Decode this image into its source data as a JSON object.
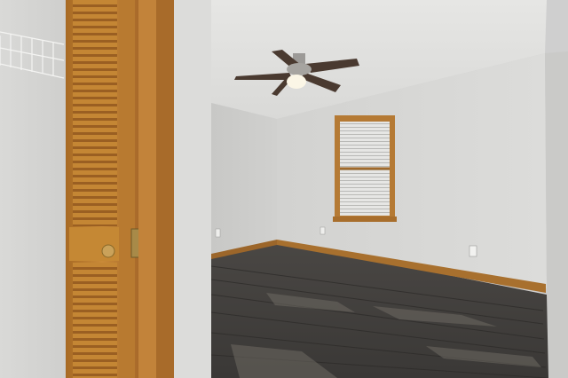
{
  "scene": {
    "kind": "photograph",
    "subject": "empty bedroom",
    "colors": {
      "wall": "#d6d6d4",
      "ceiling": "#e8e8e6",
      "wood_trim": "#b57a34",
      "door_wood": "#c0822f",
      "floor_dark": "#3f3d3b",
      "floor_light": "#6b6660",
      "fan_blade": "#4a3a30",
      "brass": "#b08a3a"
    },
    "objects": [
      "louvered-closet-door",
      "wire-closet-shelf",
      "ceiling-fan",
      "window-with-blinds",
      "baseboard",
      "wall-outlet",
      "laminate-floor"
    ]
  }
}
